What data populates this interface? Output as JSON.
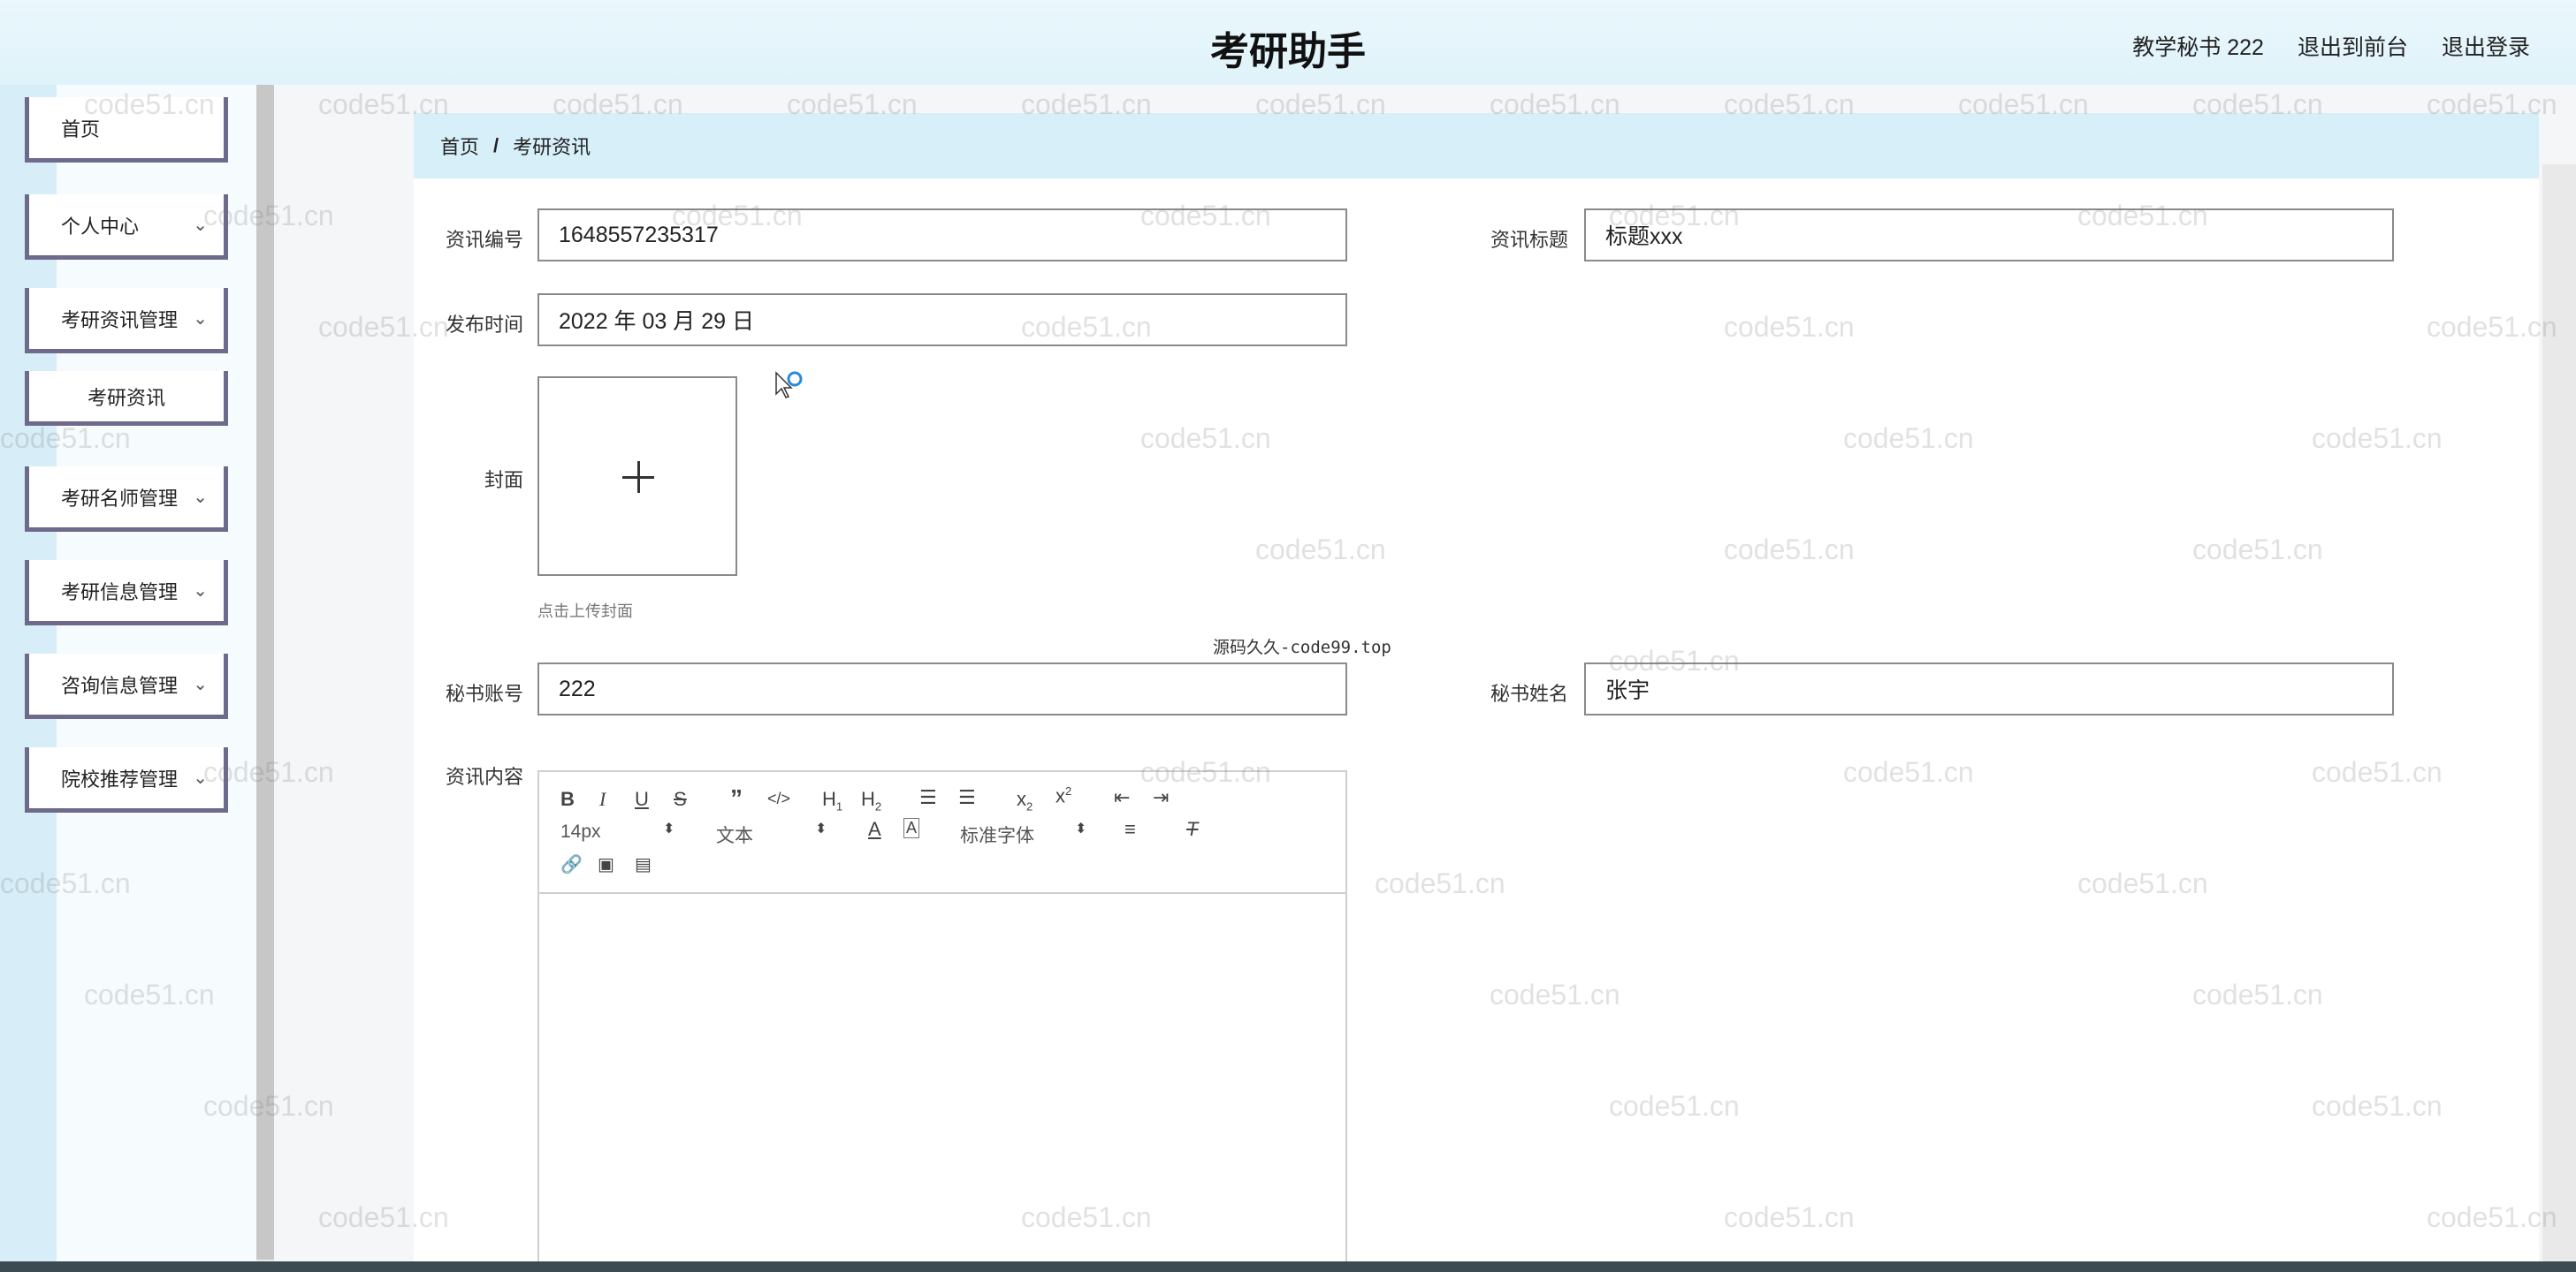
{
  "header": {
    "title": "考研助手",
    "user": "教学秘书 222",
    "to_front": "退出到前台",
    "logout": "退出登录"
  },
  "sidebar": {
    "items": [
      {
        "label": "首页"
      },
      {
        "label": "个人中心"
      },
      {
        "label": "考研资讯管理"
      },
      {
        "label": "考研资讯"
      },
      {
        "label": "考研名师管理"
      },
      {
        "label": "考研信息管理"
      },
      {
        "label": "咨询信息管理"
      },
      {
        "label": "院校推荐管理"
      }
    ]
  },
  "breadcrumb": {
    "home": "首页",
    "separator": "/",
    "current": "考研资讯"
  },
  "form": {
    "id_label": "资讯编号",
    "id_value": "1648557235317",
    "title_label": "资讯标题",
    "title_value": "标题xxx",
    "time_label": "发布时间",
    "time_value": "2022 年 03 月 29 日",
    "cover_label": "封面",
    "cover_hint": "点击上传封面",
    "account_label": "秘书账号",
    "account_value": "222",
    "name_label": "秘书姓名",
    "name_value": "张宇",
    "content_label": "资讯内容"
  },
  "editor": {
    "font_size": "14px",
    "block_type": "文本",
    "font_family": "标准字体"
  },
  "overlay_text": "源码久久-code99.top",
  "watermark": "code51.cn"
}
